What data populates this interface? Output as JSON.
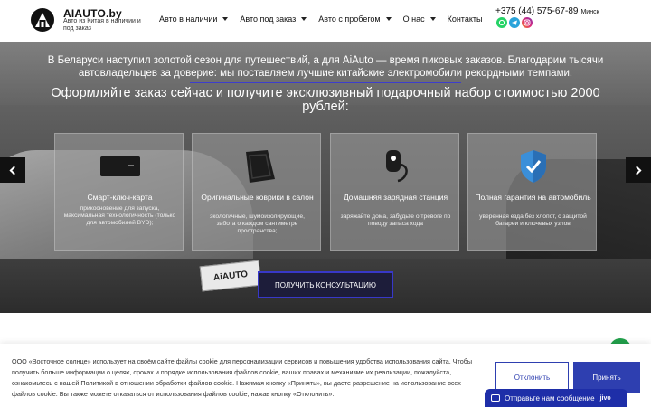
{
  "header": {
    "logo_title": "AIAUTO.by",
    "logo_subtitle": "Авто из Китая в наличии и под заказ",
    "nav": [
      {
        "label": "Авто в наличии",
        "dropdown": true
      },
      {
        "label": "Авто под заказ",
        "dropdown": true
      },
      {
        "label": "Авто с пробегом",
        "dropdown": true
      },
      {
        "label": "О нас",
        "dropdown": true
      },
      {
        "label": "Контакты",
        "dropdown": false
      }
    ],
    "phone": "+375 (44) 575-67-89",
    "city": "Минск",
    "socials": [
      {
        "name": "whatsapp-icon",
        "color": "#25D366"
      },
      {
        "name": "telegram-icon",
        "color": "#2AA3DA"
      },
      {
        "name": "instagram-icon",
        "color": "#D6249F"
      }
    ]
  },
  "hero": {
    "intro": "В Беларуси наступил золотой сезон для путешествий, а для AiAuto — время пиковых заказов. Благодарим тысячи автовладельцев за доверие: мы поставляем лучшие китайские электромобили рекордными темпами.",
    "headline": "Оформляйте заказ сейчас и получите эксклюзивный подарочный набор стоимостью 2000 рублей:",
    "plate_text": "AiAUTO",
    "cards": [
      {
        "icon": "smart-key-card-icon",
        "title": "Смарт-ключ-карта",
        "desc": "прикосновение для запуска, максимальная технологичность (только для автомобилей BYD);"
      },
      {
        "icon": "car-floor-mats-icon",
        "title": "Оригинальные коврики в салон",
        "desc": "экологичные, шумоизолирующие, забота о каждом сантиметре пространства;"
      },
      {
        "icon": "home-charging-station-icon",
        "title": "Домашняя зарядная станция",
        "desc": "заряжайте дома, забудьте о тревоге по поводу запаса хода"
      },
      {
        "icon": "warranty-shield-icon",
        "title": "Полная гарантия на автомобиль",
        "desc": "уверенная езда без хлопот, с защитой батареи и ключевых узлов"
      }
    ],
    "cta": "ПОЛУЧИТЬ КОНСУЛЬТАЦИЮ"
  },
  "cookie": {
    "text": "ООО «Восточное солнце» использует на своём сайте файлы cookie для персонализации сервисов и повышения удобства использования сайта. Чтобы получить больше информации о целях, сроках и порядке использования файлов cookie, ваших правах и механизме их реализации, пожалуйста, ознакомьтесь с нашей Политикой в отношении обработки файлов cookie. Нажимая кнопку «Принять», вы даете разрешение на использование всех файлов cookie. Вы также можете отказаться от использования файлов cookie, нажав кнопку «Отклонить».",
    "decline": "Отклонить",
    "accept": "Принять"
  },
  "chat": {
    "label": "Отправьте нам сообщение",
    "brand": "jivo"
  },
  "colors": {
    "accent": "#2e3fb0",
    "cta_border": "#3838c8",
    "chat_bg": "#1e2ea8"
  }
}
